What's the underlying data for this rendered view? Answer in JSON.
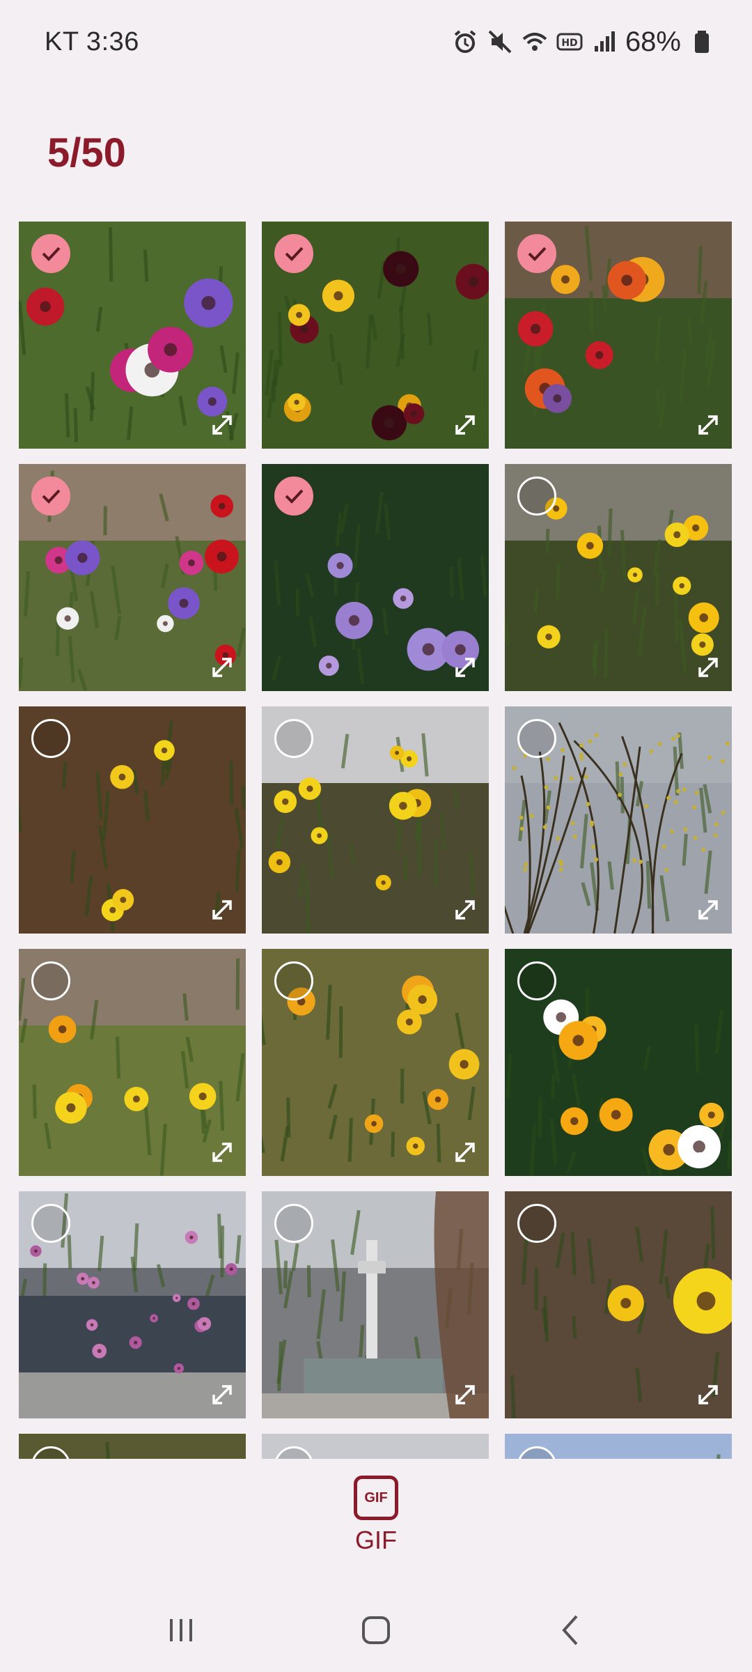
{
  "status_bar": {
    "carrier_time": "KT 3:36",
    "battery": "68%",
    "icons": [
      "alarm-icon",
      "mute-icon",
      "wifi-icon",
      "hd-icon",
      "signal-icon",
      "battery-icon"
    ]
  },
  "selection": {
    "counter": "5/50"
  },
  "colors": {
    "accent": "#8b1b2b",
    "check_selected": "#f28a9b",
    "background": "#f3eff2"
  },
  "photos": [
    {
      "selected": true,
      "subject": "anemone flowers"
    },
    {
      "selected": true,
      "subject": "pansies"
    },
    {
      "selected": true,
      "subject": "ranunculus"
    },
    {
      "selected": true,
      "subject": "red anemones by fence"
    },
    {
      "selected": true,
      "subject": "purple daisies"
    },
    {
      "selected": false,
      "subject": "daffodils hillside"
    },
    {
      "selected": false,
      "subject": "daffodils in leaves"
    },
    {
      "selected": false,
      "subject": "daffodils under trees"
    },
    {
      "selected": false,
      "subject": "yellow blossom branches"
    },
    {
      "selected": false,
      "subject": "daffodil cluster"
    },
    {
      "selected": false,
      "subject": "daffodils in grass"
    },
    {
      "selected": false,
      "subject": "yellow marigolds"
    },
    {
      "selected": false,
      "subject": "magnolia by building"
    },
    {
      "selected": false,
      "subject": "seoul tower"
    },
    {
      "selected": false,
      "subject": "single daffodil"
    },
    {
      "selected": false,
      "subject": "partial row"
    },
    {
      "selected": false,
      "subject": "partial row"
    },
    {
      "selected": false,
      "subject": "partial row"
    }
  ],
  "bottom_action": {
    "icon_text": "GIF",
    "label": "GIF"
  },
  "nav_bar": {
    "buttons": [
      "recents-icon",
      "home-icon",
      "back-icon"
    ]
  }
}
